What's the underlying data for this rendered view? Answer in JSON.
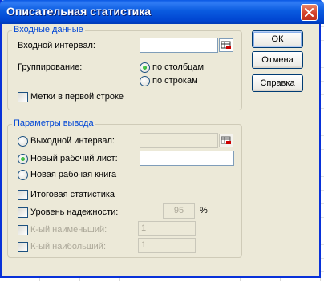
{
  "window": {
    "title": "Описательная статистика"
  },
  "input_group": {
    "legend": "Входные данные",
    "input_range_label": "Входной интервал:",
    "input_range_value": "",
    "grouping_label": "Группирование:",
    "by_columns": "по столбцам",
    "by_rows": "по строкам",
    "labels_first_row": "Метки в первой строке"
  },
  "output_group": {
    "legend": "Параметры вывода",
    "output_range": "Выходной интервал:",
    "output_range_value": "",
    "new_sheet": "Новый рабочий лист:",
    "new_sheet_value": "",
    "new_workbook": "Новая рабочая книга",
    "summary_statistics": "Итоговая статистика",
    "confidence_level": "Уровень надежности:",
    "confidence_value": "95",
    "percent_sign": "%",
    "kth_smallest": "К-ый наименьший:",
    "kth_smallest_value": "1",
    "kth_largest": "К-ый наибольший:",
    "kth_largest_value": "1"
  },
  "buttons": {
    "ok": "ОК",
    "cancel": "Отмена",
    "help": "Справка"
  }
}
